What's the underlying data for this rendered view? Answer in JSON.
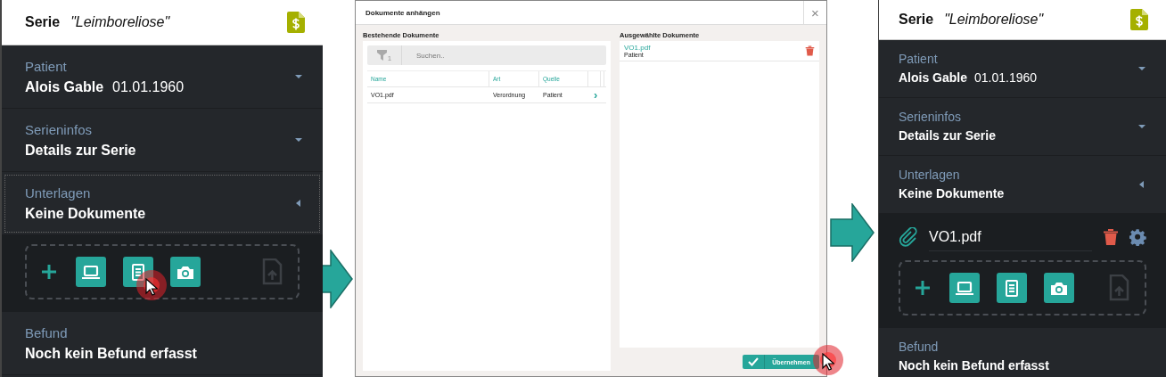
{
  "left_panel": {
    "header": {
      "label": "Serie",
      "name": "\"Leimboreliose\""
    },
    "sections": [
      {
        "label": "Patient",
        "value": "Alois Gable",
        "extra": "01.01.1960",
        "expanded": false,
        "focused": false
      },
      {
        "label": "Serieninfos",
        "value": "Details zur Serie",
        "expanded": false,
        "focused": false
      },
      {
        "label": "Unterlagen",
        "value": "Keine Dokumente",
        "expanded": true,
        "focused": true,
        "tools": [
          {
            "kind": "add",
            "pressed": false,
            "disabled": false
          },
          {
            "kind": "laptop",
            "pressed": false,
            "disabled": false
          },
          {
            "kind": "document",
            "pressed": true,
            "disabled": false
          },
          {
            "kind": "camera",
            "pressed": false,
            "disabled": false
          },
          {
            "kind": "upload",
            "pressed": false,
            "disabled": true
          }
        ]
      },
      {
        "label": "Befund",
        "value": "Noch kein Befund erfasst",
        "focused": false
      }
    ]
  },
  "dialog": {
    "title": "Dokumente anhängen",
    "close": "×",
    "existing": {
      "heading": "Bestehende Dokumente",
      "filter_count": "1",
      "search": {
        "placeholder": "Suchen.."
      },
      "columns": [
        "Name",
        "Art",
        "Quelle"
      ],
      "rows": [
        {
          "cells": [
            "VO1.pdf",
            "Verordnung",
            "Patient"
          ],
          "action": "›"
        }
      ]
    },
    "selected": {
      "heading": "Ausgewählte Dokumente",
      "items": [
        {
          "name": "VO1.pdf",
          "source": "Patient"
        }
      ]
    },
    "confirm": {
      "label": "Übernehmen",
      "pressed": true
    }
  },
  "right_panel": {
    "header": {
      "label": "Serie",
      "name": "\"Leimboreliose\""
    },
    "sections": [
      {
        "label": "Patient",
        "value": "Alois Gable",
        "extra": "01.01.1960",
        "expanded": false,
        "focused": false
      },
      {
        "label": "Serieninfos",
        "value": "Details zur Serie",
        "expanded": false,
        "focused": false
      },
      {
        "label": "Unterlagen",
        "value": "Keine Dokumente",
        "expanded": true,
        "focused": false,
        "attachments": [
          {
            "name": "VO1.pdf"
          }
        ],
        "tools": [
          {
            "kind": "add",
            "pressed": false,
            "disabled": false
          },
          {
            "kind": "laptop",
            "pressed": false,
            "disabled": false
          },
          {
            "kind": "document",
            "pressed": false,
            "disabled": false
          },
          {
            "kind": "camera",
            "pressed": false,
            "disabled": false
          },
          {
            "kind": "upload",
            "pressed": false,
            "disabled": true
          }
        ]
      },
      {
        "label": "Befund",
        "value": "Noch kein Befund erfasst",
        "focused": false
      }
    ]
  }
}
